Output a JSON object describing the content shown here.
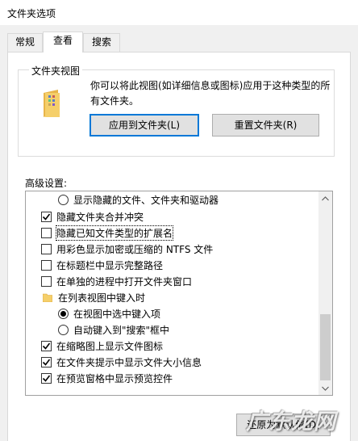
{
  "window": {
    "title": "文件夹选项"
  },
  "tabs": [
    {
      "label": "常规",
      "active": false
    },
    {
      "label": "查看",
      "active": true
    },
    {
      "label": "搜索",
      "active": false
    }
  ],
  "folder_views": {
    "group_label": "文件夹视图",
    "description": "你可以将此视图(如详细信息或图标)应用于这种类型的所有文件夹。",
    "apply_button": "应用到文件夹(L)",
    "reset_button": "重置文件夹(R)"
  },
  "advanced": {
    "label": "高级设置:",
    "items": [
      {
        "type": "radio",
        "checked": false,
        "label": "显示隐藏的文件、文件夹和驱动器"
      },
      {
        "type": "checkbox",
        "checked": true,
        "label": "隐藏文件夹合并冲突"
      },
      {
        "type": "checkbox",
        "checked": false,
        "label": "隐藏已知文件类型的扩展名",
        "focused": true
      },
      {
        "type": "checkbox",
        "checked": false,
        "label": "用彩色显示加密或压缩的 NTFS 文件"
      },
      {
        "type": "checkbox",
        "checked": false,
        "label": "在标题栏中显示完整路径"
      },
      {
        "type": "checkbox",
        "checked": false,
        "label": "在单独的进程中打开文件夹窗口"
      },
      {
        "type": "folder",
        "label": "在列表视图中键入时"
      },
      {
        "type": "radio",
        "checked": true,
        "label": "在视图中选中键入项"
      },
      {
        "type": "radio",
        "checked": false,
        "label": "自动键入到\"搜索\"框中"
      },
      {
        "type": "checkbox",
        "checked": true,
        "label": "在缩略图上显示文件图标"
      },
      {
        "type": "checkbox",
        "checked": true,
        "label": "在文件夹提示中显示文件大小信息"
      },
      {
        "type": "checkbox",
        "checked": true,
        "label": "在预览窗格中显示预览控件"
      }
    ]
  },
  "restore_button": "还原为默认值(D)",
  "watermark": "广东龙网",
  "colors": {
    "accent": "#0078d7",
    "folder": "#f5cf6a"
  }
}
